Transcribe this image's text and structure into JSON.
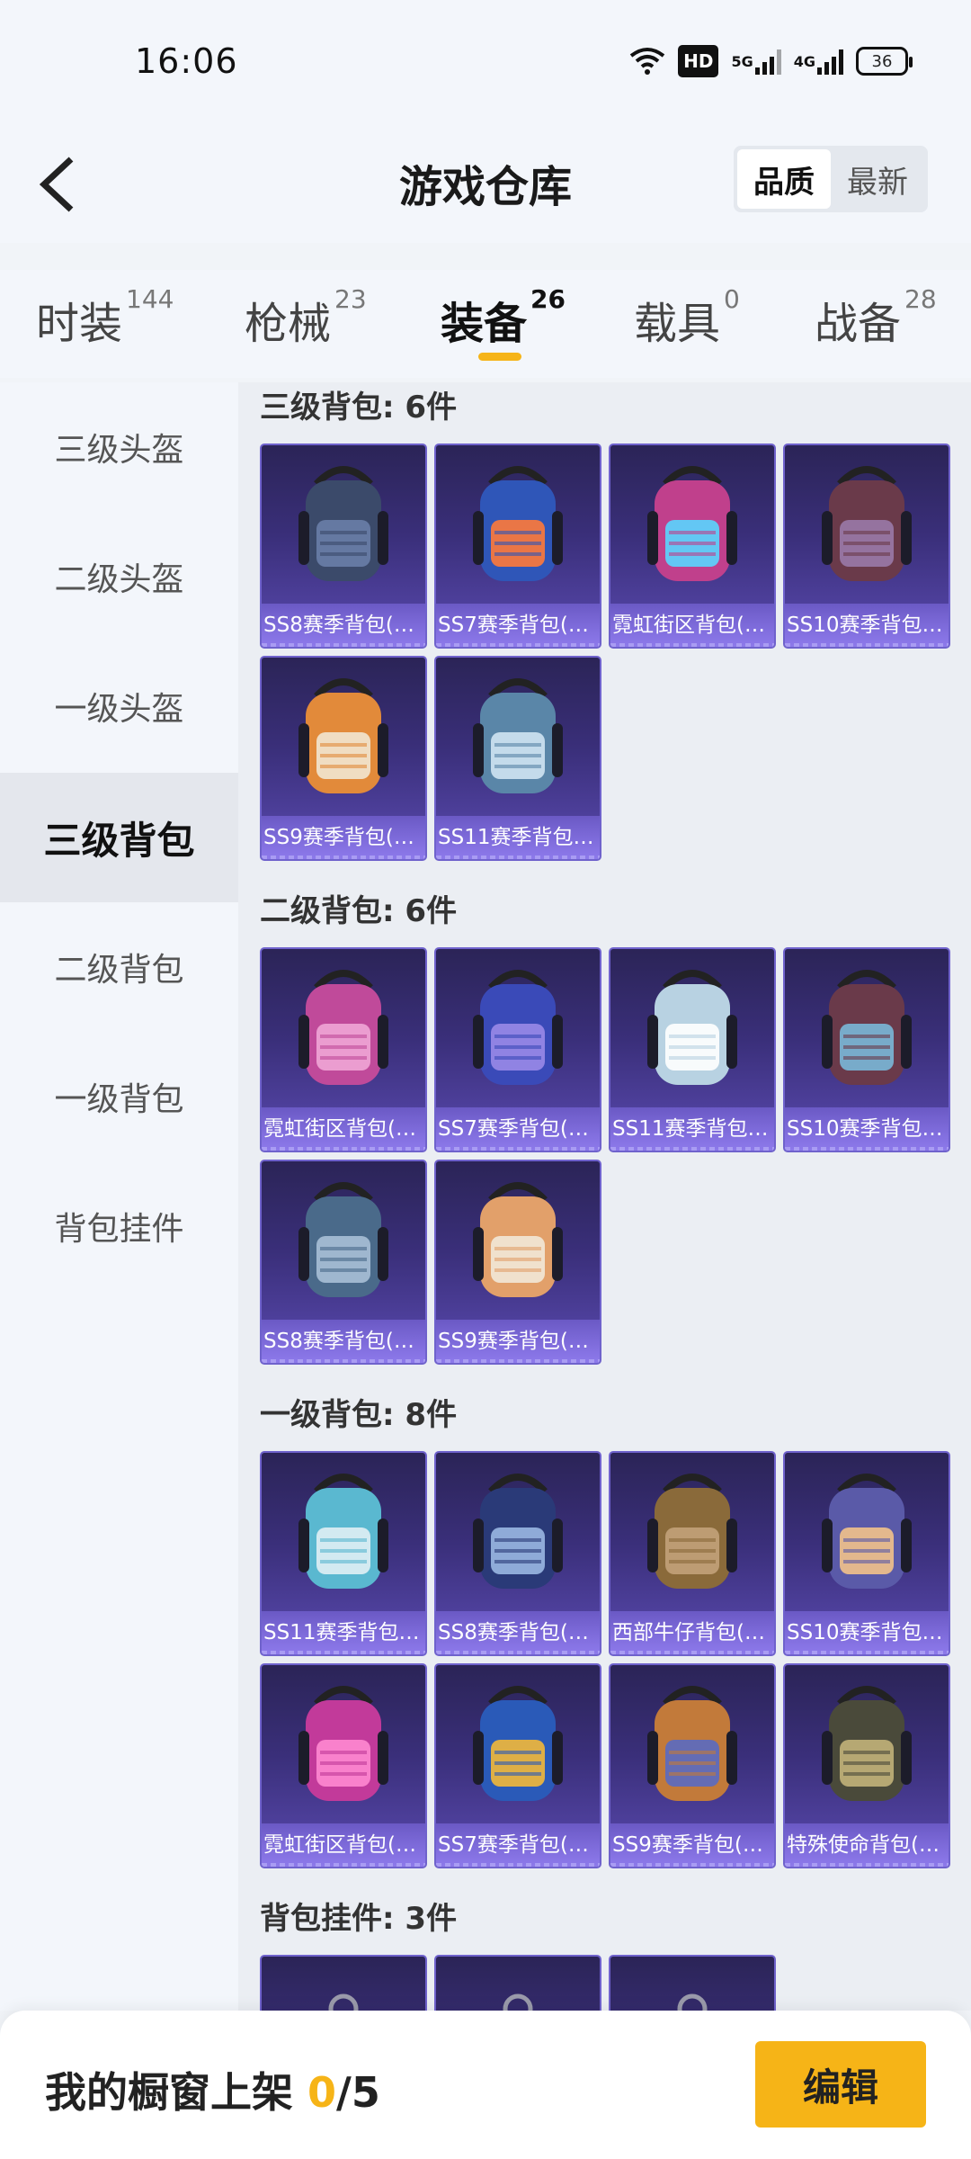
{
  "status_bar": {
    "time": "16:06",
    "hd_label": "HD",
    "net1": "5G",
    "net2": "4G",
    "battery": "36"
  },
  "header": {
    "title": "游戏仓库",
    "sort_options": [
      "品质",
      "最新"
    ],
    "active_sort": "品质"
  },
  "tabs": [
    {
      "label": "时装",
      "count": "144"
    },
    {
      "label": "枪械",
      "count": "23"
    },
    {
      "label": "装备",
      "count": "26"
    },
    {
      "label": "载具",
      "count": "0"
    },
    {
      "label": "战备",
      "count": "28"
    }
  ],
  "active_tab": "装备",
  "sidebar": {
    "items": [
      "三级头盔",
      "二级头盔",
      "一级头盔",
      "三级背包",
      "二级背包",
      "一级背包",
      "背包挂件"
    ],
    "active": "三级背包"
  },
  "sections": [
    {
      "title": "三级背包: 6件",
      "items": [
        "SS8赛季背包(3...",
        "SS7赛季背包(3...",
        "霓虹街区背包(3...",
        "SS10赛季背包(...",
        "SS9赛季背包(3...",
        "SS11赛季背包(..."
      ]
    },
    {
      "title": "二级背包: 6件",
      "items": [
        "霓虹街区背包(2...",
        "SS7赛季背包(2...",
        "SS11赛季背包(...",
        "SS10赛季背包(...",
        "SS8赛季背包(2...",
        "SS9赛季背包(2..."
      ]
    },
    {
      "title": "一级背包: 8件",
      "items": [
        "SS11赛季背包(...",
        "SS8赛季背包(1...",
        "西部牛仔背包(1...",
        "SS10赛季背包(...",
        "霓虹街区背包(1...",
        "SS7赛季背包(1...",
        "SS9赛季背包(1...",
        "特殊使命背包(1..."
      ]
    },
    {
      "title": "背包挂件: 3件",
      "items": [
        "",
        "",
        ""
      ]
    }
  ],
  "backpack_colors": {
    "s3": [
      [
        "#3b4a6a",
        "#6a7ea8"
      ],
      [
        "#2f56b8",
        "#ff7a3a"
      ],
      [
        "#c0408c",
        "#59d6ff"
      ],
      [
        "#6a3a4a",
        "#9a7aa8"
      ],
      [
        "#e28a3a",
        "#f2e6d2"
      ],
      [
        "#5a86a8",
        "#cfe4f2"
      ]
    ],
    "s2": [
      [
        "#c04a9a",
        "#f0a6d6"
      ],
      [
        "#3a4ab8",
        "#9a8ae8"
      ],
      [
        "#b8d2e2",
        "#ffffff"
      ],
      [
        "#6a3a4a",
        "#7ab8d8"
      ],
      [
        "#4a6a8a",
        "#a8c0d6"
      ],
      [
        "#e2a06a",
        "#f2e8d8"
      ]
    ],
    "s1": [
      [
        "#5ab8d0",
        "#e0f0f4"
      ],
      [
        "#2a3a78",
        "#9ab8e2"
      ],
      [
        "#8a6a3a",
        "#c2a27a"
      ],
      [
        "#5a5aa8",
        "#f2c28a"
      ],
      [
        "#c23a9a",
        "#ff8ad2"
      ],
      [
        "#2a5ab8",
        "#f2b83a"
      ],
      [
        "#c27a3a",
        "#5a6ac2"
      ],
      [
        "#4a4a3a",
        "#c2b27a"
      ]
    ],
    "charm": [
      [
        "#5a5a6a",
        "#9a9aaa"
      ],
      [
        "#5a5a6a",
        "#9a9aaa"
      ],
      [
        "#5a5a6a",
        "#9a9aaa"
      ]
    ]
  },
  "bottom": {
    "showcase_label": "我的橱窗上架",
    "current": "0",
    "max": "/5",
    "edit_label": "编辑"
  }
}
